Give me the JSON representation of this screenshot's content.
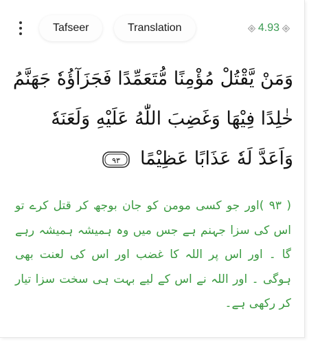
{
  "toolbar": {
    "menu_icon": "more-vertical-icon",
    "tabs": [
      {
        "label": "Tafseer"
      },
      {
        "label": "Translation"
      }
    ],
    "verse_number": "4.93",
    "accent_color": "#3a9a52"
  },
  "verse": {
    "arabic_text": "وَمَنْ يَّقْتُلْ مُؤْمِنًا مُّتَعَمِّدًا فَجَزَآؤُهٗ جَهَنَّمُ خٰلِدًا فِيْهَا وَغَضِبَ اللّٰهُ عَلَيْهِ وَلَعَنَهٗ وَاَعَدَّ لَهٗ عَذَابًا عَظِيْمًا",
    "ayah_marker": "٩٣"
  },
  "translation": {
    "urdu_text": "( ۹۳ )اور جو کسی مومن کو جان بوجھ کر قتل کرے تو اس کی سزا جہنم ہے جس میں وہ ہمیشہ ہمیشہ رہے گا ۔ اور اس پر اللہ کا غضب اور اس کی لعنت بھی ہوگی ۔ اور اللہ نے اس کے لیے بہت ہی سخت سزا تیار کر رکھی ہے۔",
    "text_color": "#3a9a40"
  }
}
